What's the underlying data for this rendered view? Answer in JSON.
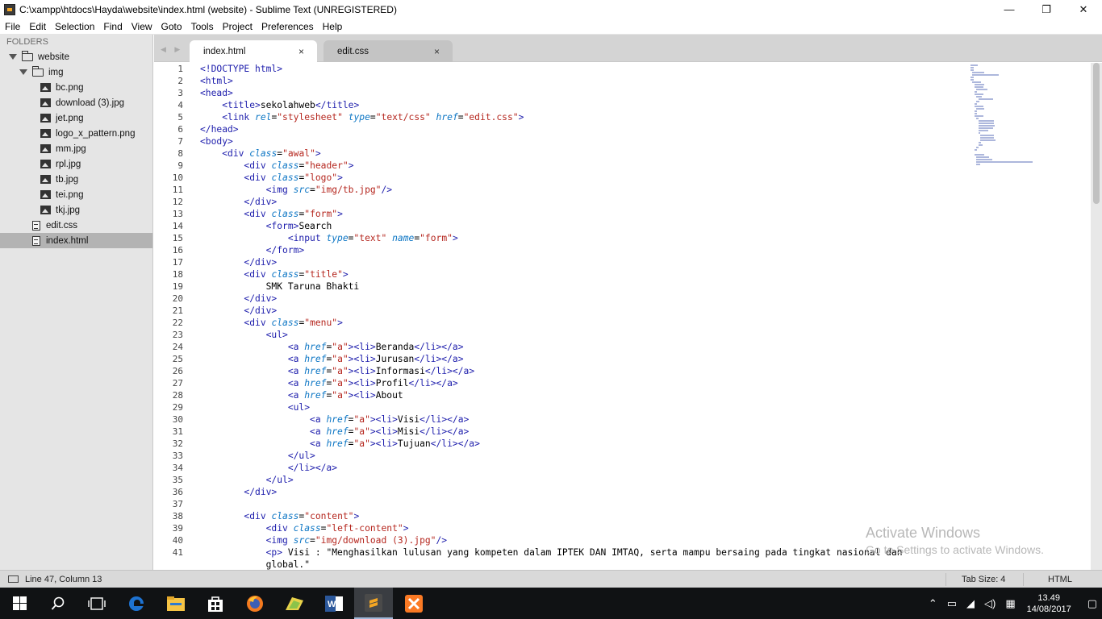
{
  "window": {
    "title": "C:\\xampp\\htdocs\\Hayda\\website\\index.html (website) - Sublime Text (UNREGISTERED)",
    "controls": {
      "minimize": "—",
      "maximize": "❐",
      "close": "✕"
    }
  },
  "menu": [
    "File",
    "Edit",
    "Selection",
    "Find",
    "View",
    "Goto",
    "Tools",
    "Project",
    "Preferences",
    "Help"
  ],
  "sidebar": {
    "header": "FOLDERS",
    "root": "website",
    "img_folder": "img",
    "img_files": [
      "bc.png",
      "download (3).jpg",
      "jet.png",
      "logo_x_pattern.png",
      "mm.jpg",
      "rpl.jpg",
      "tb.jpg",
      "tei.png",
      "tkj.jpg"
    ],
    "files": [
      "edit.css",
      "index.html"
    ],
    "selected": "index.html"
  },
  "tabs": [
    {
      "label": "index.html",
      "close": "×",
      "active": true
    },
    {
      "label": "edit.css",
      "close": "×",
      "active": false
    }
  ],
  "nav_arrows": "◀ ▶",
  "editor": {
    "line_numbers": [
      "1",
      "2",
      "3",
      "4",
      "5",
      "6",
      "7",
      "8",
      "9",
      "10",
      "11",
      "12",
      "13",
      "14",
      "15",
      "16",
      "17",
      "18",
      "19",
      "20",
      "21",
      "22",
      "23",
      "24",
      "25",
      "26",
      "27",
      "28",
      "29",
      "30",
      "31",
      "32",
      "33",
      "34",
      "35",
      "36",
      "37",
      "38",
      "39",
      "40",
      "41",
      ""
    ],
    "lines": [
      [
        [
          "t",
          "<!DOCTYPE html>"
        ]
      ],
      [
        [
          "t",
          "<html>"
        ]
      ],
      [
        [
          "t",
          "<head>"
        ]
      ],
      [
        [
          "p",
          "    "
        ],
        [
          "t",
          "<title>"
        ],
        [
          "p",
          "sekolahweb"
        ],
        [
          "t",
          "</title>"
        ]
      ],
      [
        [
          "p",
          "    "
        ],
        [
          "t",
          "<link "
        ],
        [
          "a",
          "rel"
        ],
        [
          "p",
          "="
        ],
        [
          "s",
          "\"stylesheet\""
        ],
        [
          "p",
          " "
        ],
        [
          "a",
          "type"
        ],
        [
          "p",
          "="
        ],
        [
          "s",
          "\"text/css\""
        ],
        [
          "p",
          " "
        ],
        [
          "a",
          "href"
        ],
        [
          "p",
          "="
        ],
        [
          "s",
          "\"edit.css\""
        ],
        [
          "t",
          ">"
        ]
      ],
      [
        [
          "t",
          "</head>"
        ]
      ],
      [
        [
          "t",
          "<body>"
        ]
      ],
      [
        [
          "p",
          "    "
        ],
        [
          "t",
          "<div "
        ],
        [
          "a",
          "class"
        ],
        [
          "p",
          "="
        ],
        [
          "s",
          "\"awal\""
        ],
        [
          "t",
          ">"
        ]
      ],
      [
        [
          "p",
          "        "
        ],
        [
          "t",
          "<div "
        ],
        [
          "a",
          "class"
        ],
        [
          "p",
          "="
        ],
        [
          "s",
          "\"header\""
        ],
        [
          "t",
          ">"
        ]
      ],
      [
        [
          "p",
          "        "
        ],
        [
          "t",
          "<div "
        ],
        [
          "a",
          "class"
        ],
        [
          "p",
          "="
        ],
        [
          "s",
          "\"logo\""
        ],
        [
          "t",
          ">"
        ]
      ],
      [
        [
          "p",
          "            "
        ],
        [
          "t",
          "<img "
        ],
        [
          "a",
          "src"
        ],
        [
          "p",
          "="
        ],
        [
          "s",
          "\"img/tb.jpg\""
        ],
        [
          "t",
          "/>"
        ]
      ],
      [
        [
          "p",
          "        "
        ],
        [
          "t",
          "</div>"
        ]
      ],
      [
        [
          "p",
          "        "
        ],
        [
          "t",
          "<div "
        ],
        [
          "a",
          "class"
        ],
        [
          "p",
          "="
        ],
        [
          "s",
          "\"form\""
        ],
        [
          "t",
          ">"
        ]
      ],
      [
        [
          "p",
          "            "
        ],
        [
          "t",
          "<form>"
        ],
        [
          "p",
          "Search"
        ]
      ],
      [
        [
          "p",
          "                "
        ],
        [
          "t",
          "<input "
        ],
        [
          "a",
          "type"
        ],
        [
          "p",
          "="
        ],
        [
          "s",
          "\"text\""
        ],
        [
          "p",
          " "
        ],
        [
          "a",
          "name"
        ],
        [
          "p",
          "="
        ],
        [
          "s",
          "\"form\""
        ],
        [
          "t",
          ">"
        ]
      ],
      [
        [
          "p",
          "            "
        ],
        [
          "t",
          "</form>"
        ]
      ],
      [
        [
          "p",
          "        "
        ],
        [
          "t",
          "</div>"
        ]
      ],
      [
        [
          "p",
          "        "
        ],
        [
          "t",
          "<div "
        ],
        [
          "a",
          "class"
        ],
        [
          "p",
          "="
        ],
        [
          "s",
          "\"title\""
        ],
        [
          "t",
          ">"
        ]
      ],
      [
        [
          "p",
          "            SMK Taruna Bhakti"
        ]
      ],
      [
        [
          "p",
          "        "
        ],
        [
          "t",
          "</div>"
        ]
      ],
      [
        [
          "p",
          "        "
        ],
        [
          "t",
          "</div>"
        ]
      ],
      [
        [
          "p",
          "        "
        ],
        [
          "t",
          "<div "
        ],
        [
          "a",
          "class"
        ],
        [
          "p",
          "="
        ],
        [
          "s",
          "\"menu\""
        ],
        [
          "t",
          ">"
        ]
      ],
      [
        [
          "p",
          "            "
        ],
        [
          "t",
          "<ul>"
        ]
      ],
      [
        [
          "p",
          "                "
        ],
        [
          "t",
          "<a "
        ],
        [
          "a",
          "href"
        ],
        [
          "p",
          "="
        ],
        [
          "s",
          "\"a\""
        ],
        [
          "t",
          "><li>"
        ],
        [
          "p",
          "Beranda"
        ],
        [
          "t",
          "</li></a>"
        ]
      ],
      [
        [
          "p",
          "                "
        ],
        [
          "t",
          "<a "
        ],
        [
          "a",
          "href"
        ],
        [
          "p",
          "="
        ],
        [
          "s",
          "\"a\""
        ],
        [
          "t",
          "><li>"
        ],
        [
          "p",
          "Jurusan"
        ],
        [
          "t",
          "</li></a>"
        ]
      ],
      [
        [
          "p",
          "                "
        ],
        [
          "t",
          "<a "
        ],
        [
          "a",
          "href"
        ],
        [
          "p",
          "="
        ],
        [
          "s",
          "\"a\""
        ],
        [
          "t",
          "><li>"
        ],
        [
          "p",
          "Informasi"
        ],
        [
          "t",
          "</li></a>"
        ]
      ],
      [
        [
          "p",
          "                "
        ],
        [
          "t",
          "<a "
        ],
        [
          "a",
          "href"
        ],
        [
          "p",
          "="
        ],
        [
          "s",
          "\"a\""
        ],
        [
          "t",
          "><li>"
        ],
        [
          "p",
          "Profil"
        ],
        [
          "t",
          "</li></a>"
        ]
      ],
      [
        [
          "p",
          "                "
        ],
        [
          "t",
          "<a "
        ],
        [
          "a",
          "href"
        ],
        [
          "p",
          "="
        ],
        [
          "s",
          "\"a\""
        ],
        [
          "t",
          "><li>"
        ],
        [
          "p",
          "About"
        ]
      ],
      [
        [
          "p",
          "                "
        ],
        [
          "t",
          "<ul>"
        ]
      ],
      [
        [
          "p",
          "                    "
        ],
        [
          "t",
          "<a "
        ],
        [
          "a",
          "href"
        ],
        [
          "p",
          "="
        ],
        [
          "s",
          "\"a\""
        ],
        [
          "t",
          "><li>"
        ],
        [
          "p",
          "Visi"
        ],
        [
          "t",
          "</li></a>"
        ]
      ],
      [
        [
          "p",
          "                    "
        ],
        [
          "t",
          "<a "
        ],
        [
          "a",
          "href"
        ],
        [
          "p",
          "="
        ],
        [
          "s",
          "\"a\""
        ],
        [
          "t",
          "><li>"
        ],
        [
          "p",
          "Misi"
        ],
        [
          "t",
          "</li></a>"
        ]
      ],
      [
        [
          "p",
          "                    "
        ],
        [
          "t",
          "<a "
        ],
        [
          "a",
          "href"
        ],
        [
          "p",
          "="
        ],
        [
          "s",
          "\"a\""
        ],
        [
          "t",
          "><li>"
        ],
        [
          "p",
          "Tujuan"
        ],
        [
          "t",
          "</li></a>"
        ]
      ],
      [
        [
          "p",
          "                "
        ],
        [
          "t",
          "</ul>"
        ]
      ],
      [
        [
          "p",
          "                "
        ],
        [
          "t",
          "</li></a>"
        ]
      ],
      [
        [
          "p",
          "            "
        ],
        [
          "t",
          "</ul>"
        ]
      ],
      [
        [
          "p",
          "        "
        ],
        [
          "t",
          "</div>"
        ]
      ],
      [
        [
          "p",
          ""
        ]
      ],
      [
        [
          "p",
          "        "
        ],
        [
          "t",
          "<div "
        ],
        [
          "a",
          "class"
        ],
        [
          "p",
          "="
        ],
        [
          "s",
          "\"content\""
        ],
        [
          "t",
          ">"
        ]
      ],
      [
        [
          "p",
          "            "
        ],
        [
          "t",
          "<div "
        ],
        [
          "a",
          "class"
        ],
        [
          "p",
          "="
        ],
        [
          "s",
          "\"left-content\""
        ],
        [
          "t",
          ">"
        ]
      ],
      [
        [
          "p",
          "            "
        ],
        [
          "t",
          "<img "
        ],
        [
          "a",
          "src"
        ],
        [
          "p",
          "="
        ],
        [
          "s",
          "\"img/download (3).jpg\""
        ],
        [
          "t",
          "/>"
        ]
      ],
      [
        [
          "p",
          "            "
        ],
        [
          "t",
          "<p>"
        ],
        [
          "p",
          " Visi : \"Menghasilkan lulusan yang kompeten dalam IPTEK DAN IMTAQ, serta mampu bersaing pada tingkat nasional dan"
        ]
      ],
      [
        [
          "p",
          "            global.\""
        ]
      ]
    ]
  },
  "watermark": {
    "line1": "Activate Windows",
    "line2": "Go to Settings to activate Windows."
  },
  "status": {
    "position": "Line 47, Column 13",
    "tab_size": "Tab Size: 4",
    "syntax": "HTML"
  },
  "taskbar": {
    "apps": [
      "windows-start-icon",
      "search-icon",
      "task-view-icon",
      "edge-icon",
      "file-explorer-icon",
      "store-icon",
      "firefox-icon",
      "photos-icon",
      "word-icon",
      "sublime-text-icon",
      "xampp-icon"
    ],
    "active_app": "sublime-text-icon",
    "time": "13.49",
    "date": "14/08/2017"
  },
  "colors": {
    "tag": "#1d1dac",
    "attribute": "#0b75c4",
    "string": "#b5261e",
    "sidebar_bg": "#e5e5e5",
    "taskbar_bg": "#101214"
  }
}
